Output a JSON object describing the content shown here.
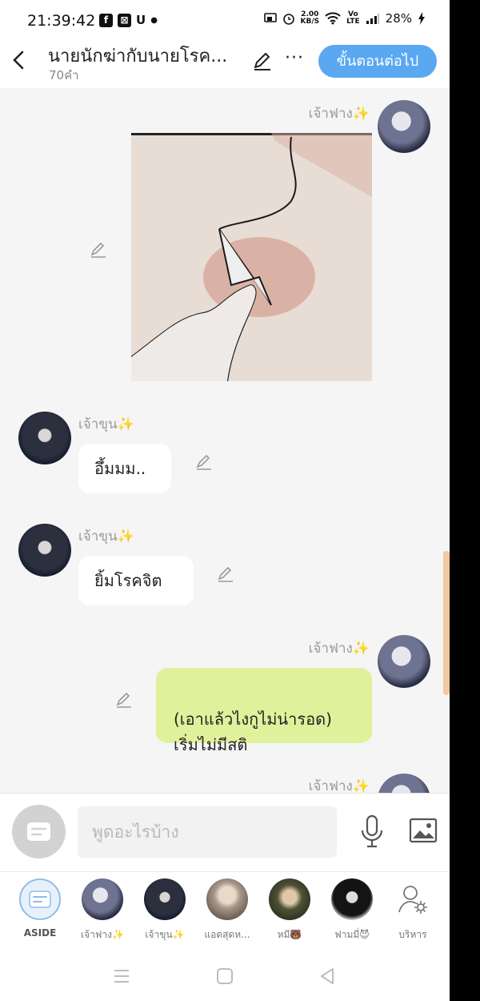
{
  "status_bar": {
    "time": "21:39:42",
    "notif_icons": [
      "facebook-icon",
      "capcut-icon",
      "u-icon",
      "dot"
    ],
    "net_speed_top": "2.00",
    "net_speed_bottom": "KB/S",
    "battery": "28%"
  },
  "header": {
    "title": "นายนักฆ่ากับนายโรค...",
    "word_count": "70คำ",
    "more_label": "···",
    "next_button": "ขั้นตอนต่อไป"
  },
  "messages": [
    {
      "side": "right",
      "name": "เจ้าฟาง",
      "sparkle": "✨",
      "type": "image"
    },
    {
      "side": "left",
      "name": "เจ้าขุน",
      "sparkle": "✨",
      "text": "อึ้มมม.."
    },
    {
      "side": "left",
      "name": "เจ้าขุน",
      "sparkle": "✨",
      "text": "ยิ้มโรคจิต"
    },
    {
      "side": "right",
      "name": "เจ้าฟาง",
      "sparkle": "✨",
      "text": "(เอาแล้วไงกูไม่น่ารอด)\nเริ่มไม่มีสติ"
    },
    {
      "side": "right",
      "name": "เจ้าฟาง",
      "sparkle": "✨",
      "partial": true
    }
  ],
  "input": {
    "placeholder": "พูดอะไรบ้าง"
  },
  "characters": [
    {
      "label": "ASIDE"
    },
    {
      "label": "เจ้าฟาง✨"
    },
    {
      "label": "เจ้าขุน✨"
    },
    {
      "label": "แอดสุดห..."
    },
    {
      "label": "หมี🐻"
    },
    {
      "label": "ฟามมี่😈"
    },
    {
      "label": "บริหาร"
    }
  ],
  "colors": {
    "accent": "#5aa8f2",
    "green_bubble": "#dff29b",
    "sparkle": "#f4c430"
  }
}
